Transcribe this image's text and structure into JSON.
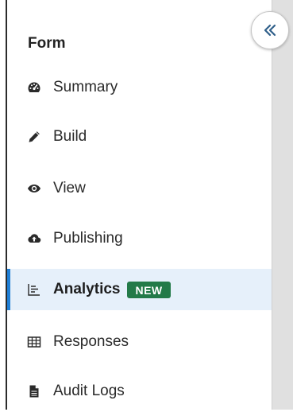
{
  "sidebar": {
    "title": "Form",
    "items": [
      {
        "label": "Summary",
        "icon": "dashboard-icon"
      },
      {
        "label": "Build",
        "icon": "pencil-icon"
      },
      {
        "label": "View",
        "icon": "eye-icon"
      },
      {
        "label": "Publishing",
        "icon": "cloud-upload-icon"
      },
      {
        "label": "Analytics",
        "icon": "analytics-icon",
        "badge": "NEW",
        "active": true
      },
      {
        "label": "Responses",
        "icon": "table-icon"
      },
      {
        "label": "Audit Logs",
        "icon": "document-icon"
      }
    ]
  },
  "colors": {
    "active_bg": "#e6f0fa",
    "active_border": "#1f7fd6",
    "badge_bg": "#237a48",
    "text": "#2a2a2a"
  },
  "collapse_button": {
    "icon": "double-chevron-left-icon"
  }
}
